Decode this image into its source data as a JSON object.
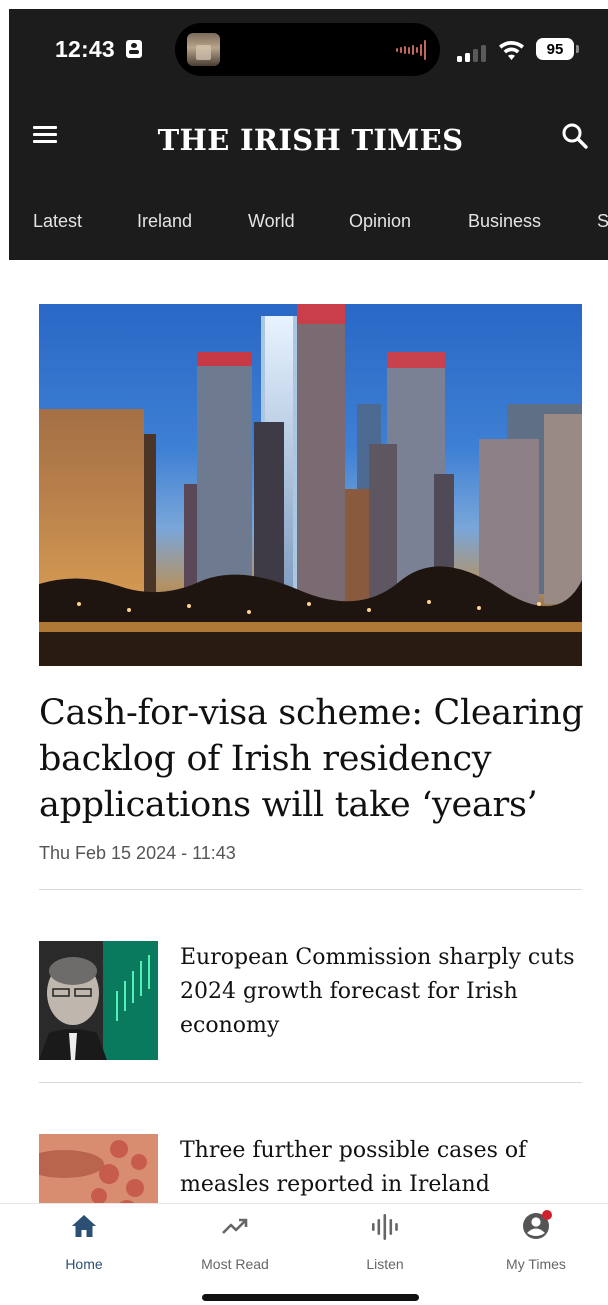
{
  "status_bar": {
    "time": "12:43",
    "battery": "95",
    "icons": [
      "id-badge-icon",
      "album-art-thumbnail",
      "audio-waveform-icon",
      "cellular-signal-icon",
      "wifi-icon",
      "battery-icon"
    ]
  },
  "header": {
    "masthead": "THE IRISH TIMES",
    "menu_icon": "hamburger-menu-icon",
    "search_icon": "search-icon",
    "background_color": "#1c1c1c"
  },
  "nav": {
    "tabs": [
      {
        "label": "Latest"
      },
      {
        "label": "Ireland"
      },
      {
        "label": "World"
      },
      {
        "label": "Opinion"
      },
      {
        "label": "Business"
      },
      {
        "label": "S"
      }
    ]
  },
  "lead_story": {
    "image": "city-skyline-at-dusk",
    "headline": "Cash-for-visa scheme: Clearing backlog of Irish residency applications will take ‘years’",
    "date": "Thu Feb 15 2024 - 11:43"
  },
  "stories": [
    {
      "title": "European Commission sharply cuts 2024 growth forecast for Irish economy",
      "image": "politician-portrait-with-chart"
    },
    {
      "title": "Three further possible cases of measles reported in Ireland",
      "image": "measles-rash-closeup"
    }
  ],
  "tab_bar": {
    "accent_color": "#2c4f74",
    "notification_color": "#d0202e",
    "items": [
      {
        "label": "Home",
        "icon": "home-icon",
        "active": true
      },
      {
        "label": "Most Read",
        "icon": "trending-up-icon",
        "active": false
      },
      {
        "label": "Listen",
        "icon": "audio-bars-icon",
        "active": false
      },
      {
        "label": "My Times",
        "icon": "account-icon",
        "active": false
      }
    ]
  }
}
